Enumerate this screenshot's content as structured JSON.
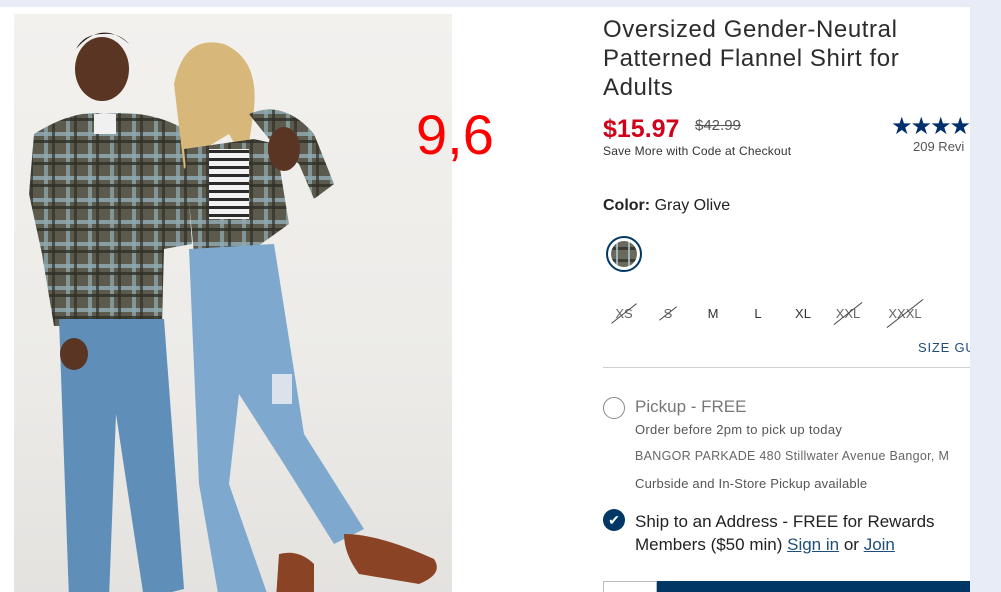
{
  "overlay": {
    "label": "9,6"
  },
  "product": {
    "title": "Oversized Gender-Neutral Patterned Flannel Shirt for Adults",
    "price": "$15.97",
    "original_price": "$42.99",
    "promo": "Save More with Code at Checkout",
    "rating_stars": "★★★★★",
    "reviews": "209 Revi",
    "color_label": "Color:",
    "color_value": "Gray Olive",
    "size_guide": "SIZE GU"
  },
  "sizes": [
    {
      "label": "XS",
      "available": false
    },
    {
      "label": "S",
      "available": false
    },
    {
      "label": "M",
      "available": true
    },
    {
      "label": "L",
      "available": true
    },
    {
      "label": "XL",
      "available": true
    },
    {
      "label": "XXL",
      "available": false
    },
    {
      "label": "XXXL",
      "available": false
    }
  ],
  "fulfillment": {
    "pickup_title": "Pickup - FREE",
    "pickup_subtitle": "Order before 2pm to pick up today",
    "store": "BANGOR PARKADE 480 Stillwater Avenue  Bangor, M",
    "curbside": "Curbside and In-Store Pickup available",
    "ship_text": "Ship to an Address - FREE for Rewards Members ($50 min)",
    "sign_in": "Sign in",
    "or": "or",
    "join": "Join"
  },
  "colors": {
    "price_red": "#d0021b",
    "navy": "#003764",
    "overlay_red": "#ff0000"
  }
}
